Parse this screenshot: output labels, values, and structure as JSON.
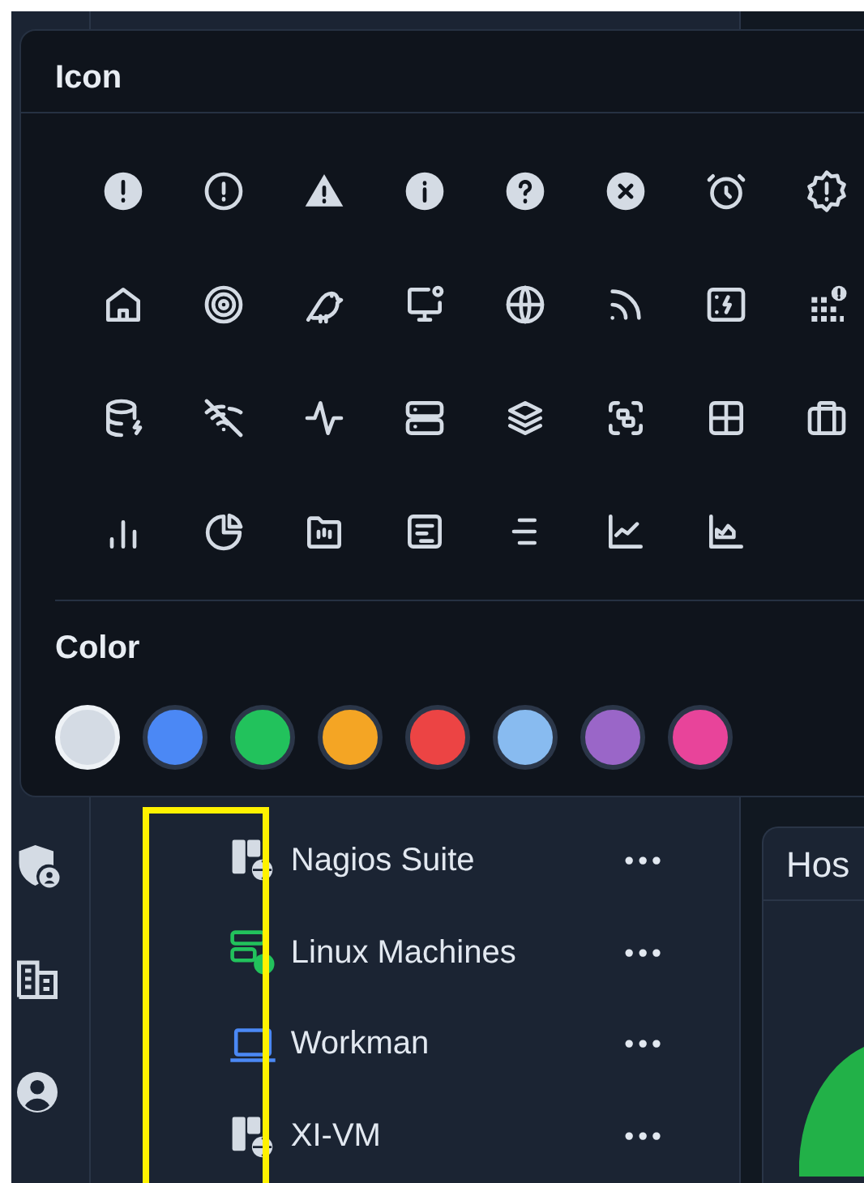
{
  "icon_picker": {
    "icon_title": "Icon",
    "color_title": "Color",
    "colors": [
      {
        "color": "#d4dbe4",
        "selected": true
      },
      {
        "color": "#4b88f5",
        "selected": false
      },
      {
        "color": "#22c25c",
        "selected": false
      },
      {
        "color": "#f4a524",
        "selected": false
      },
      {
        "color": "#ec4444",
        "selected": false
      },
      {
        "color": "#88bbf0",
        "selected": false
      },
      {
        "color": "#9a66c8",
        "selected": false
      },
      {
        "color": "#e8449a",
        "selected": false
      }
    ]
  },
  "hosts": [
    {
      "name": "Nagios Suite",
      "kind": "server-globe",
      "color": "#d4dbe4",
      "menu": "•••"
    },
    {
      "name": "Linux Machines",
      "kind": "servers-globe",
      "color": "#22c25c",
      "menu": "•••"
    },
    {
      "name": "Workman",
      "kind": "laptop",
      "color": "#4b88f5",
      "menu": "•••"
    },
    {
      "name": "XI-VM",
      "kind": "server-globe",
      "color": "#d4dbe4",
      "menu": "•••"
    }
  ],
  "side_card": {
    "title": "Hos"
  }
}
